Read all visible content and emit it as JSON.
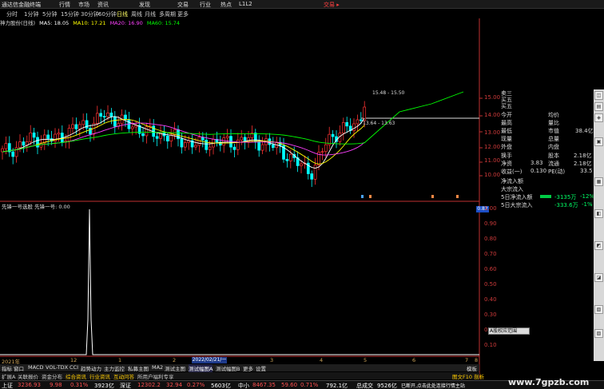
{
  "app": {
    "title": "通达信金融终端",
    "menu": [
      "行情",
      "市场",
      "资讯",
      "发现",
      "交易",
      "行业",
      "热点",
      "L1L2"
    ],
    "trade_btn": "交易 ▸"
  },
  "periods": [
    "分时",
    "1分钟",
    "5分钟",
    "15分钟",
    "30分钟",
    "60分钟",
    "日线",
    "周线",
    "月线",
    "多周期",
    "更多"
  ],
  "active_period": "日线",
  "stock_label": "神力股份(日线)",
  "ma": [
    {
      "label": "MA5: 18.05",
      "color": "#ffffff"
    },
    {
      "label": "MA10: 17.21",
      "color": "#ffff00"
    },
    {
      "label": "MA20: 16.90",
      "color": "#ff40ff"
    },
    {
      "label": "MA60: 15.74",
      "color": "#00ff00"
    }
  ],
  "annotations": {
    "high": "15.48 - 15.50",
    "low": "13.64 - 13.63"
  },
  "price_axis": [
    "15.00",
    "14.00",
    "13.00",
    "12.00",
    "11.00",
    "10.00"
  ],
  "panel": {
    "rows": [
      {
        "l": "卖三",
        "m": "",
        "r": ""
      },
      {
        "l": "买五",
        "m": "",
        "r": ""
      },
      {
        "l": "今开",
        "m": "",
        "r": "均价"
      },
      {
        "l": "最高",
        "m": "",
        "r": "量比"
      },
      {
        "l": "最低",
        "m": "",
        "r": "市值"
      },
      {
        "l": "现量",
        "m": "",
        "r": "总量"
      },
      {
        "l": "外盘",
        "m": "",
        "r": "内盘"
      }
    ],
    "misc": {
      "mktcap": "38.4亿",
      "turnover_l": "换手",
      "turnover_r": "股本",
      "turnover_v": "2.18亿",
      "net_l": "净资",
      "net_v": "3.83",
      "flow_l": "流通",
      "flow_v": "2.18亿",
      "pe_l": "收益(一)",
      "pe_v": "0.130",
      "pe_r": "PE(动)",
      "pe_rv": "33.5",
      "inflow1": "净流入额",
      "inflow2": "大宗流入",
      "d5_inflow": "5日净流入额",
      "d5_val": "-3135万",
      "d5_pct": "-12%",
      "d5_big": "5日大宗流入",
      "d5_big_val": "-333.6万",
      "d5_big_pct": "-1%"
    }
  },
  "indicator2": {
    "title": "先锋一号选股  先锋一号: 0.00",
    "value_tag": "0.82",
    "axis": [
      "1.00",
      "0.90",
      "0.80",
      "0.70",
      "0.60",
      "0.50",
      "0.40",
      "0.30",
      "0.20",
      "0.10"
    ]
  },
  "time_axis": [
    "2021年",
    "12",
    "1",
    "2",
    "3",
    "4",
    "5",
    "6",
    "7",
    "8",
    "E"
  ],
  "date_box": "2022/02/21/一",
  "tabs": [
    "指标",
    "窗口",
    "MACD",
    "VOL-TDX",
    "CCI",
    "趋势动力",
    "主力监控",
    "私募主图",
    "MA2",
    "测试主图",
    "测试幅图A",
    "测试幅图B",
    "更多",
    "设置"
  ],
  "tab_right": "模板",
  "tabs2": [
    {
      "t": "扩展A",
      "c": "#dddddd"
    },
    {
      "t": "关联报价",
      "c": "#dddddd"
    },
    {
      "t": "资金分布",
      "c": "#dddddd"
    },
    {
      "t": "综合资讯",
      "c": "#ffcc00"
    },
    {
      "t": "行业资讯",
      "c": "#ffcc00"
    },
    {
      "t": "互动问答",
      "c": "#ffcc00"
    },
    {
      "t": "所用户福利专享",
      "c": "#dddddd"
    }
  ],
  "tabs2_right": "图文F10  剖析",
  "status": [
    {
      "t": "上证",
      "c": "#ffffff"
    },
    {
      "t": "3236.93",
      "c": "#ff5050"
    },
    {
      "t": "9.98",
      "c": "#ff5050"
    },
    {
      "t": "0.31%",
      "c": "#ff5050"
    },
    {
      "t": "3923亿",
      "c": "#ffffff"
    },
    {
      "t": "深证",
      "c": "#ffffff"
    },
    {
      "t": "12302.2",
      "c": "#ff5050"
    },
    {
      "t": "32.94",
      "c": "#ff5050"
    },
    {
      "t": "0.27%",
      "c": "#ff5050"
    },
    {
      "t": "5603亿",
      "c": "#ffffff"
    },
    {
      "t": "中小",
      "c": "#ffffff"
    },
    {
      "t": "8467.35",
      "c": "#ff5050"
    },
    {
      "t": "59.60",
      "c": "#ff5050"
    },
    {
      "t": "0.71%",
      "c": "#ff5050"
    },
    {
      "t": "792.1亿",
      "c": "#ffffff"
    },
    {
      "t": "总成交",
      "c": "#ffffff"
    },
    {
      "t": "9526亿",
      "c": "#ffffff"
    },
    {
      "t": "已断开,点击此处连接行情主站",
      "c": "#ffffff"
    }
  ],
  "tooltip": "A股权应范围",
  "watermark": "www.7gpzb.com",
  "colors": {
    "up": "#ff3232",
    "down": "#00ffff",
    "ma5": "#ffffff",
    "ma10": "#ffff00",
    "ma20": "#ff40ff",
    "ma60": "#00ff00"
  }
}
